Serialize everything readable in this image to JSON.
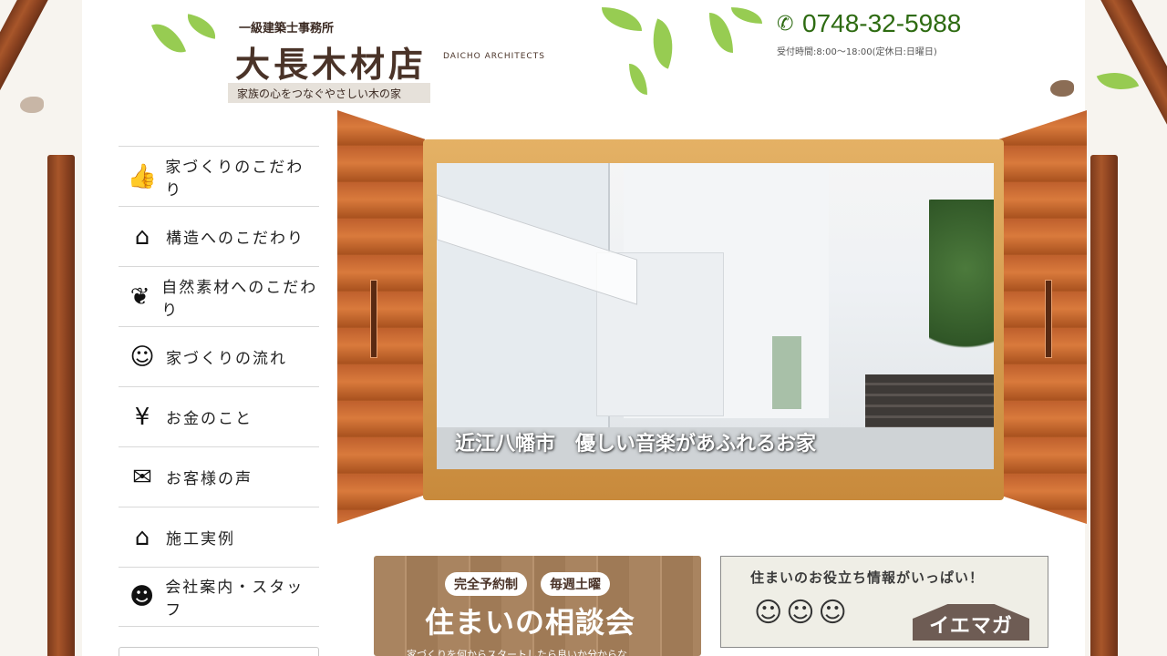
{
  "header": {
    "logo_sub": "一級建築士事務所",
    "logo_main": "大長木材店",
    "logo_en": "DAICHO ARCHITECTS",
    "tagline": "家族の心をつなぐやさしい木の家",
    "phone": "0748-32-5988",
    "hours": "受付時間:8:00～18:00(定休日:日曜日)"
  },
  "nav": {
    "items": [
      {
        "icon": "👍",
        "label": "家づくりのこだわり"
      },
      {
        "icon": "⌂",
        "label": "構造へのこだわり"
      },
      {
        "icon": "❦",
        "label": "自然素材へのこだわり"
      },
      {
        "icon": "☺",
        "label": "家づくりの流れ"
      },
      {
        "icon": "¥",
        "label": "お金のこと"
      },
      {
        "icon": "✉",
        "label": "お客様の声"
      },
      {
        "icon": "⌂",
        "label": "施工実例"
      },
      {
        "icon": "☻",
        "label": "会社案内・スタッフ"
      }
    ]
  },
  "hero": {
    "caption": "近江八幡市　優しい音楽があふれるお家"
  },
  "banner_consult": {
    "pill_1": "完全予約制",
    "pill_2": "毎週土曜",
    "title": "住まいの相談会",
    "subtitle": "家づくりを何からスタートしたら良いか分からな"
  },
  "banner_iemaga": {
    "text": "住まいのお役立ち情報がいっぱい！",
    "logo": "イエマガ"
  },
  "colors": {
    "phone": "#2e6b12",
    "wood": "#c0612e",
    "frame": "#e4b165"
  }
}
